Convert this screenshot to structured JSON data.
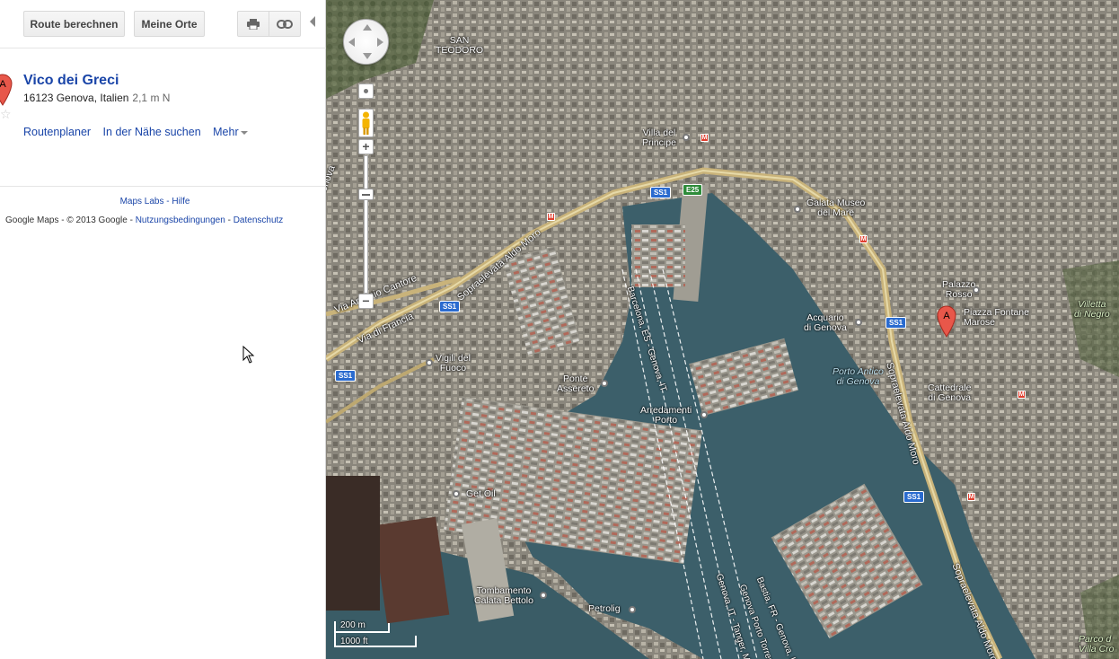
{
  "toolbar": {
    "route_label": "Route berechnen",
    "places_label": "Meine Orte",
    "print_icon": "print-icon",
    "link_icon": "link-icon"
  },
  "result": {
    "marker": "A",
    "title": "Vico dei Greci",
    "address": "16123 Genova, Italien",
    "distance": "2,1 m N",
    "links": [
      "Routenplaner",
      "In der Nähe suchen",
      "Mehr"
    ]
  },
  "footer_links": {
    "labs": "Maps Labs",
    "sep": "-",
    "help": "Hilfe"
  },
  "footer": {
    "brand": "Google Maps",
    "copyright": "- © 2013 Google",
    "terms_sep": "-",
    "terms": "Nutzungsbedingungen",
    "privacy_sep": "-",
    "privacy": "Datenschutz"
  },
  "map": {
    "marker": "A",
    "labels": {
      "san_teodoro": "SAN\nTEODORO",
      "villa_principe": "Villa del\nPrincipe",
      "galata": "Galata Museo\ndel Mare",
      "palazzo_rosso": "Palazzo\nRosso",
      "piazza_fontane": "Piazza Fontane\nMarose",
      "villetta": "Villetta\ndi Negro",
      "acquario": "Acquario\ndi Genova",
      "porto_antico": "Porto Antico\ndi Genova",
      "cattedrale": "Cattedrale\ndi Genova",
      "vigili": "Vigili del\nFuoco",
      "ponte": "Ponte\nAssereto",
      "arredamenti": "Arredamenti\nPorto",
      "get_oil": "Get Oil",
      "tombamento": "Tombamento\nCalata Bettolo",
      "petrolig": "Petrolig",
      "parco": "Parco d\nVilla Cro",
      "genova_left": "Genova"
    },
    "roads": {
      "via_cantore": "Via Antonio Cantore",
      "via_francia": "Via di Francia",
      "sopraelevata_1": "Sopraelevata Aldo Moro",
      "sopraelevata_2": "Sopraelevata Aldo Moro",
      "sopraelevata_3": "Sopraelevata Aldo Moro",
      "ferry_1": "Barcelona, ES - Genova, IT",
      "ferry_2": "Genova, IT - Tanger, MA",
      "ferry_3": "Genova Porto Torres",
      "ferry_4": "Bastia, FR - Genova, IT"
    },
    "shields": {
      "ss1_a": "SS1",
      "e25": "E25",
      "ss1_b": "SS1",
      "ss1_c": "SS1",
      "ss1_d": "SS1",
      "ss1_e": "SS1"
    },
    "metro_symbol": "M",
    "scale": {
      "metric": "200 m",
      "imperial": "1000 ft"
    }
  }
}
